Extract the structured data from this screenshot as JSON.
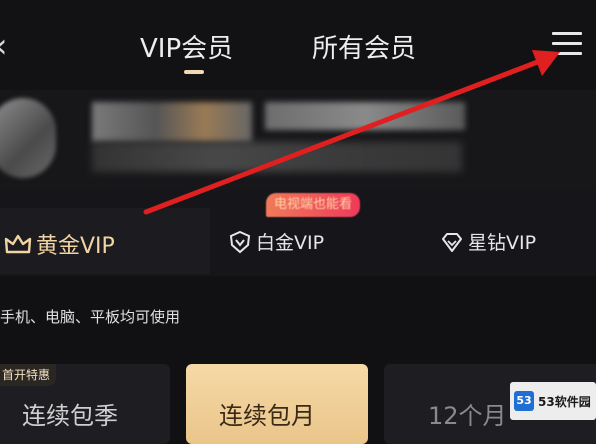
{
  "header": {
    "back_icon": "chevron-left-icon",
    "tabs": [
      {
        "label": "VIP会员",
        "active": true
      },
      {
        "label": "所有会员",
        "active": false
      }
    ],
    "menu_icon": "hamburger-menu-icon",
    "indicator_color": "#f0d9b5"
  },
  "tiers": {
    "promo_badge": "电视端也能看",
    "items": [
      {
        "label": "黄金VIP",
        "icon": "crown-icon",
        "selected": true,
        "color": "#f2d4a4"
      },
      {
        "label": "白金VIP",
        "icon": "shield-v-icon",
        "selected": false,
        "color": "#e6e6e6"
      },
      {
        "label": "星钻VIP",
        "icon": "diamond-icon",
        "selected": false,
        "color": "#e6e6e6"
      }
    ]
  },
  "description": "手机、电脑、平板均可使用",
  "plans": {
    "tag": "首开特惠",
    "items": [
      {
        "label": "连续包季",
        "selected": false
      },
      {
        "label": "连续包月",
        "selected": true
      },
      {
        "label": "12个月",
        "selected": false
      }
    ]
  },
  "watermark": {
    "logo": "53",
    "title": "53软件园"
  },
  "annotation": {
    "arrow_color": "#e02020"
  }
}
